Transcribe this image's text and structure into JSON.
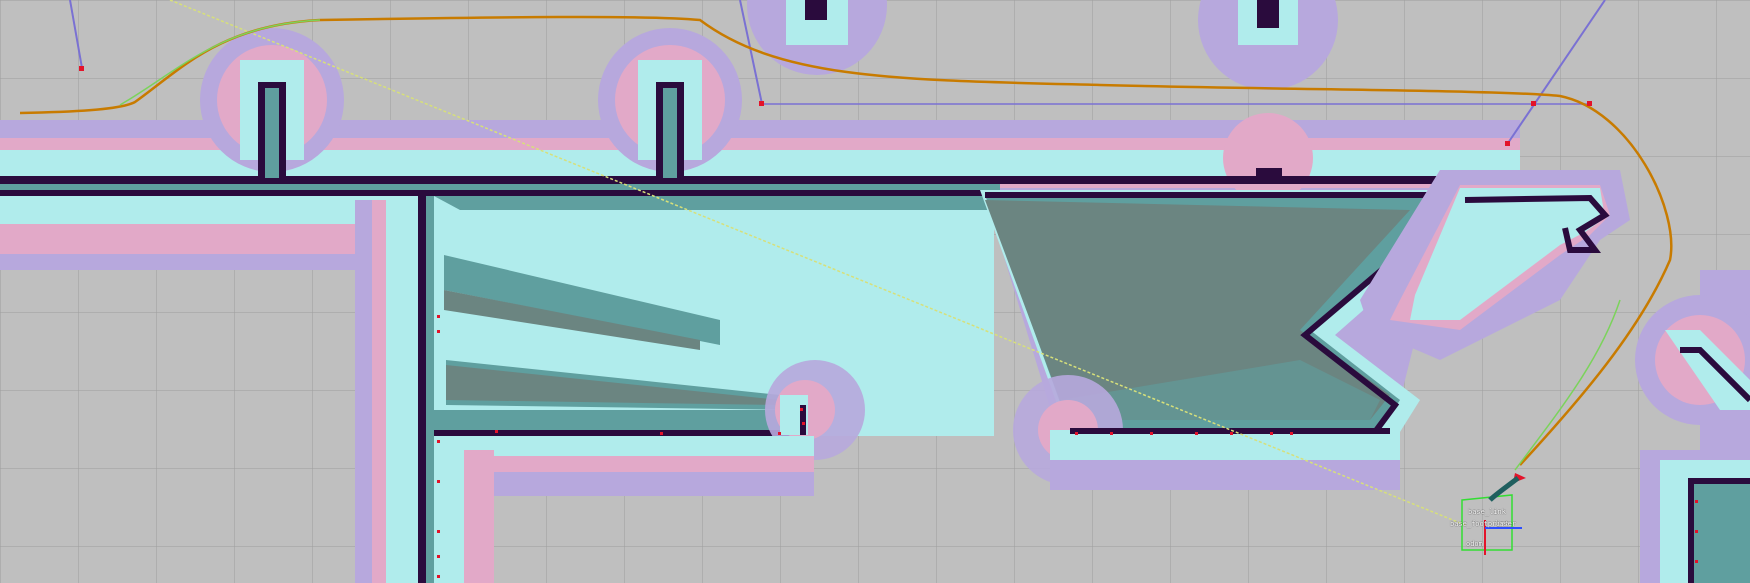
{
  "window": {
    "title": ""
  },
  "colors": {
    "background": "#bfbfbf",
    "grid": "#a0a0a0",
    "inflation_outer": "#b7a8dd",
    "inflation_mid": "#e2a9c8",
    "inflation_inner": "#b0ecec",
    "obstacle": "#2a0b3d",
    "known_free": "#5f9f9f",
    "unknown_grey": "#6b8581",
    "global_plan": "#c87b00",
    "local_plan": "#7bd35b",
    "direct_line": "#d7e07a",
    "waypoint": "#e3132a",
    "waypoint_line": "#7a71d3",
    "robot_footprint": "#33dd33"
  },
  "robot": {
    "labels": [
      "base_link",
      "base_footprint",
      "laser",
      "odom"
    ]
  }
}
